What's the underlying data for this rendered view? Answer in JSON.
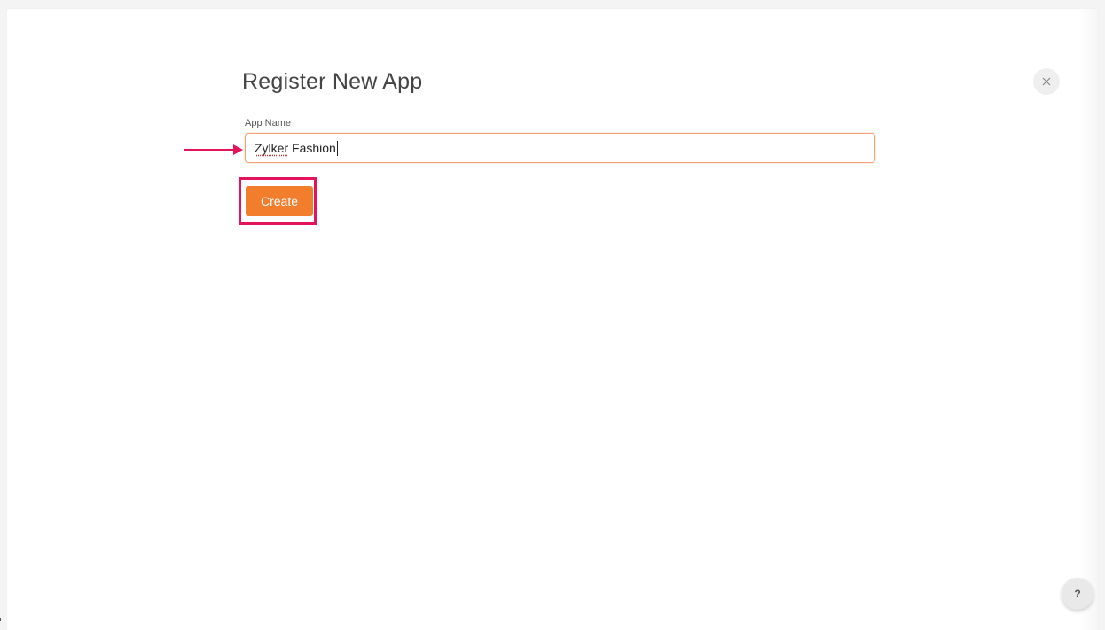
{
  "dialog": {
    "title": "Register New App",
    "field_label": "App Name",
    "input_value_misspelled": "Zylker",
    "input_value_rest": " Fashion",
    "create_label": "Create",
    "help_label": "?"
  },
  "icons": {
    "close": "close-icon",
    "arrow": "arrow-right-icon",
    "help": "question-icon"
  },
  "colors": {
    "accent_orange": "#f27d2c",
    "annotation_pink": "#e5145a",
    "input_focus_border": "#f4a274"
  }
}
